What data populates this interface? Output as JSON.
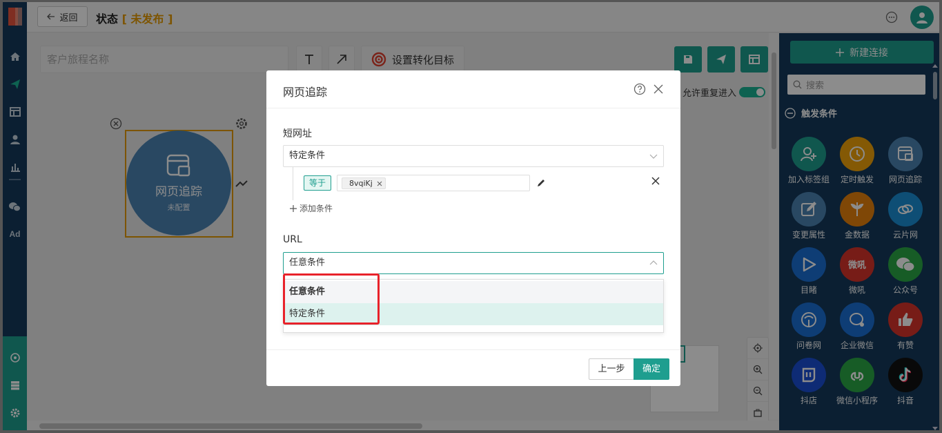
{
  "header": {
    "back_label": "返回",
    "title": "状态",
    "status_open": "[",
    "status": "未发布",
    "status_close": "]"
  },
  "toolbar": {
    "journey_name_placeholder": "客户旅程名称",
    "goal_label": "设置转化目标",
    "allow_repeat_label": "允许重复进入",
    "allow_repeat_on": true
  },
  "node": {
    "title": "网页追踪",
    "subtitle": "未配置"
  },
  "panel": {
    "new_connection_label": "新建连接",
    "search_placeholder": "搜索",
    "section_title": "触发条件",
    "items": [
      {
        "label": "加入标签组",
        "icon": "user-add-icon",
        "color": "#1e9e8f"
      },
      {
        "label": "定时触发",
        "icon": "clock-icon",
        "color": "#f0a30a"
      },
      {
        "label": "网页追踪",
        "icon": "web-page-icon",
        "color": "#4b84b3"
      },
      {
        "label": "变更属性",
        "icon": "edit-icon",
        "color": "#4b84b3"
      },
      {
        "label": "金数据",
        "icon": "jinshuju-icon",
        "color": "#e8820c"
      },
      {
        "label": "云片网",
        "icon": "yunpian-icon",
        "color": "#1b8fd6"
      },
      {
        "label": "目睹",
        "icon": "play-icon",
        "color": "#1b6fd6"
      },
      {
        "label": "微吼",
        "icon": "vhall-icon",
        "color": "#d9342b"
      },
      {
        "label": "公众号",
        "icon": "wechat-icon",
        "color": "#2aa845"
      },
      {
        "label": "问卷网",
        "icon": "wenjuan-icon",
        "color": "#1b6fd6"
      },
      {
        "label": "企业微信",
        "icon": "wecom-icon",
        "color": "#1b6fd6"
      },
      {
        "label": "有赞",
        "icon": "thumb-up-icon",
        "color": "#d9342b"
      },
      {
        "label": "抖店",
        "icon": "doudian-icon",
        "color": "#1b4fd6"
      },
      {
        "label": "微信小程序",
        "icon": "miniprogram-icon",
        "color": "#2aa845"
      },
      {
        "label": "抖音",
        "icon": "tiktok-icon",
        "color": "#111111"
      }
    ]
  },
  "modal": {
    "title": "网页追踪",
    "short_url_label": "短网址",
    "short_url_mode": "特定条件",
    "condition_operator": "等于",
    "condition_value": "8vqiKj",
    "add_condition_label": "添加条件",
    "url_label": "URL",
    "url_mode": "任意条件",
    "url_options": [
      "任意条件",
      "特定条件"
    ],
    "prev_label": "上一步",
    "ok_label": "确定"
  },
  "colors": {
    "brand": "#1e9e8f",
    "rail": "#143a5c",
    "status": "#e39a00",
    "highlight": "#e8222a"
  }
}
